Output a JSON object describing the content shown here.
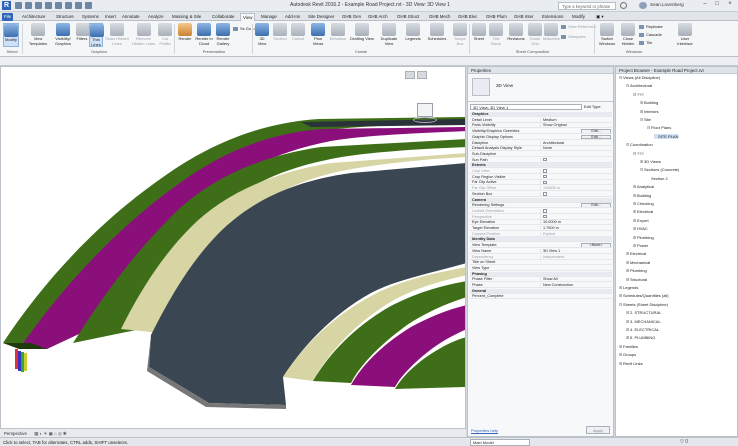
{
  "titlebar": {
    "title": "Autodesk Revit 2016.2 - Example Road Project.rvt - 3D View: 3D View 1",
    "search_placeholder": "Type a keyword or phrase",
    "user": "Sean.Lovenberg"
  },
  "tabs": [
    "File",
    "Architecture",
    "Structure",
    "Systems",
    "Insert",
    "Annotate",
    "Analyze",
    "Massing & Site",
    "Collaborate",
    "View",
    "Manage",
    "Add-Ins",
    "Site Designer",
    "GHB Gen",
    "GHB Arch",
    "GHB Struct",
    "GHB Mech",
    "GHB Elec",
    "GHB Plum",
    "GHB Inter",
    "Extensions",
    "Modify"
  ],
  "ribbon": {
    "buttons": [
      {
        "label": "Modify"
      },
      {
        "label": "View Templates"
      },
      {
        "label": "Visibility/ Graphics"
      },
      {
        "label": "Filters"
      },
      {
        "label": "Thin Lines"
      },
      {
        "label": "Show Hidden Lines"
      },
      {
        "label": "Remove Hidden Lines"
      },
      {
        "label": "Cut Profile"
      },
      {
        "label": "Render"
      },
      {
        "label": "Render in Cloud"
      },
      {
        "label": "Render Gallery"
      },
      {
        "label": "3D View"
      },
      {
        "label": "Section"
      },
      {
        "label": "Callout"
      },
      {
        "label": "Plan Views"
      },
      {
        "label": "Elevation"
      },
      {
        "label": "Drafting View"
      },
      {
        "label": "Duplicate View"
      },
      {
        "label": "Legends"
      },
      {
        "label": "Schedules"
      },
      {
        "label": "Scope Box"
      },
      {
        "label": "Sheet"
      },
      {
        "label": "Title Block"
      },
      {
        "label": "Revisions"
      },
      {
        "label": "Guide Grid"
      },
      {
        "label": "Matchline"
      },
      {
        "label": "Switch Windows"
      },
      {
        "label": "Close Hidden"
      },
      {
        "label": "User Interface"
      }
    ],
    "mini": [
      "Ss Go Live",
      "View Reference",
      "Viewports",
      "Replicate",
      "Cascade",
      "Tile"
    ],
    "groups": [
      "Select",
      "Graphics",
      "Presentation",
      "Create",
      "Sheet Composition",
      "Windows"
    ]
  },
  "optbar": {
    "text": ""
  },
  "viewport": {
    "view_bar_label": "Perspective",
    "viewcube_label": "FRONT"
  },
  "properties": {
    "title": "Properties",
    "type_name": "3D View",
    "selector": "3D View: 3D View 1",
    "edit_type": "Edit Type",
    "rows": [
      {
        "k": "Graphics",
        "sec": true
      },
      {
        "k": "Detail Level",
        "v": "Medium"
      },
      {
        "k": "Parts Visibility",
        "v": "Show Original"
      },
      {
        "k": "Visibility/Graphics Overrides",
        "btn": "Edit..."
      },
      {
        "k": "Graphic Display Options",
        "btn": "Edit..."
      },
      {
        "k": "Discipline",
        "v": "Architectural"
      },
      {
        "k": "Default Analysis Display Style",
        "v": "None"
      },
      {
        "k": "Sub-Discipline",
        "v": ""
      },
      {
        "k": "Sun Path",
        "cb": true
      },
      {
        "k": "Extents",
        "sec": true
      },
      {
        "k": "Crop View",
        "cb": true,
        "dim": true
      },
      {
        "k": "Crop Region Visible",
        "cb": true
      },
      {
        "k": "Far Clip Active",
        "cb": true
      },
      {
        "k": "Far Clip Offset",
        "v": "130808 m",
        "dim": true
      },
      {
        "k": "Section Box",
        "cb": true
      },
      {
        "k": "Camera",
        "sec": true
      },
      {
        "k": "Rendering Settings",
        "btn": "Edit..."
      },
      {
        "k": "Locked Orientation",
        "cb": true,
        "dim": true
      },
      {
        "k": "Perspective",
        "cb": true,
        "dim": true
      },
      {
        "k": "Eye Elevation",
        "v": "10.0000 m"
      },
      {
        "k": "Target Elevation",
        "v": "1.7500 m"
      },
      {
        "k": "Camera Position",
        "v": "Explicit",
        "dim": true
      },
      {
        "k": "Identity Data",
        "sec": true
      },
      {
        "k": "View Template",
        "btn": "<None>"
      },
      {
        "k": "View Name",
        "v": "3D View 1"
      },
      {
        "k": "Dependency",
        "v": "Independent",
        "dim": true
      },
      {
        "k": "Title on Sheet",
        "v": ""
      },
      {
        "k": "View Type",
        "v": ""
      },
      {
        "k": "Phasing",
        "sec": true
      },
      {
        "k": "Phase Filter",
        "v": "Show All"
      },
      {
        "k": "Phase",
        "v": "New Construction"
      },
      {
        "k": "General",
        "sec": true
      },
      {
        "k": "Percent_Complete",
        "v": ""
      }
    ],
    "help": "Properties help",
    "apply": "Apply"
  },
  "browser": {
    "title": "Project Browser - Example Road Project.rvt",
    "items": [
      {
        "t": "Views (All Discipline)",
        "l": 0,
        "ex": "-"
      },
      {
        "t": "Architectural",
        "l": 1,
        "ex": "-"
      },
      {
        "t": "???",
        "l": 2,
        "ex": "-"
      },
      {
        "t": "Building",
        "l": 3,
        "ex": "+"
      },
      {
        "t": "Interiors",
        "l": 3,
        "ex": "+"
      },
      {
        "t": "Site",
        "l": 3,
        "ex": "-"
      },
      {
        "t": "Floor Plans",
        "l": 4,
        "ex": "-"
      },
      {
        "t": "SITE PLAN",
        "l": 5,
        "ex": "",
        "hl": true
      },
      {
        "t": "Coordination",
        "l": 1,
        "ex": "-"
      },
      {
        "t": "???",
        "l": 2,
        "ex": "-"
      },
      {
        "t": "3D Views",
        "l": 3,
        "ex": "+"
      },
      {
        "t": "Sections (Concrete)",
        "l": 3,
        "ex": "-"
      },
      {
        "t": "Section 2",
        "l": 4,
        "ex": ""
      },
      {
        "t": "Analytical",
        "l": 2,
        "ex": "+"
      },
      {
        "t": "Building",
        "l": 2,
        "ex": "+"
      },
      {
        "t": "Checking",
        "l": 2,
        "ex": "+"
      },
      {
        "t": "Electrical",
        "l": 2,
        "ex": "+"
      },
      {
        "t": "Export",
        "l": 2,
        "ex": "+"
      },
      {
        "t": "HVAC",
        "l": 2,
        "ex": "+"
      },
      {
        "t": "Plumbing",
        "l": 2,
        "ex": "+"
      },
      {
        "t": "Power",
        "l": 2,
        "ex": "+"
      },
      {
        "t": "Electrical",
        "l": 1,
        "ex": "+"
      },
      {
        "t": "Mechanical",
        "l": 1,
        "ex": "+"
      },
      {
        "t": "Plumbing",
        "l": 1,
        "ex": "+"
      },
      {
        "t": "Structural",
        "l": 1,
        "ex": "+"
      },
      {
        "t": "Legends",
        "l": 0,
        "ex": "+"
      },
      {
        "t": "Schedules/Quantities (all)",
        "l": 0,
        "ex": "+"
      },
      {
        "t": "Sheets (Sheet Discipline)",
        "l": 0,
        "ex": "-"
      },
      {
        "t": "2. STRUCTURAL",
        "l": 1,
        "ex": "+"
      },
      {
        "t": "3. MECHANICAL",
        "l": 1,
        "ex": "+"
      },
      {
        "t": "4. ELECTRICAL",
        "l": 1,
        "ex": "+"
      },
      {
        "t": "5. PLUMBING",
        "l": 1,
        "ex": "+"
      },
      {
        "t": "Families",
        "l": 0,
        "ex": "+"
      },
      {
        "t": "Groups",
        "l": 0,
        "ex": "+"
      },
      {
        "t": "Revit Links",
        "l": 0,
        "ex": "+"
      }
    ]
  },
  "status": {
    "text": "Click to select, TAB for alternates, CTRL adds, SHIFT unselects.",
    "model": "Main Model"
  },
  "colors": {
    "road": "#3a4651",
    "grass": "#3e6f18",
    "magenta": "#8a0f7a",
    "curb": "#d7d5a3"
  }
}
